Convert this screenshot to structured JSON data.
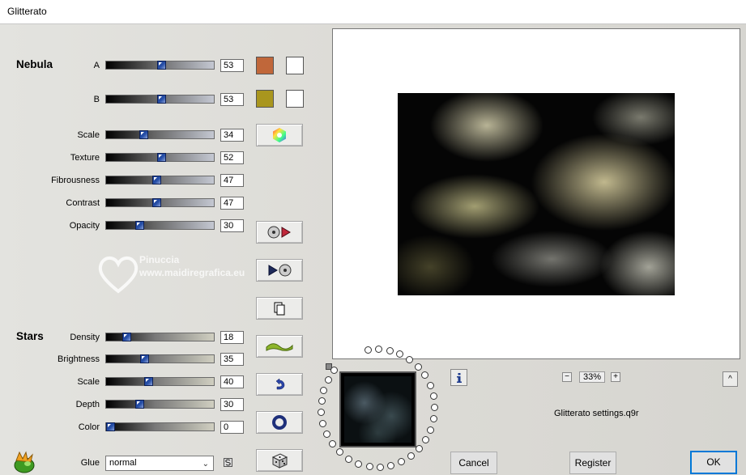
{
  "window": {
    "title": "Glitterato"
  },
  "nebula": {
    "title": "Nebula",
    "a": {
      "label": "A",
      "value": "53",
      "color": "#c0673a"
    },
    "b": {
      "label": "B",
      "value": "53",
      "color": "#a9961e"
    },
    "scale": {
      "label": "Scale",
      "value": "34"
    },
    "texture": {
      "label": "Texture",
      "value": "52"
    },
    "fibrousness": {
      "label": "Fibrousness",
      "value": "47"
    },
    "contrast": {
      "label": "Contrast",
      "value": "47"
    },
    "opacity": {
      "label": "Opacity",
      "value": "30"
    }
  },
  "stars": {
    "title": "Stars",
    "density": {
      "label": "Density",
      "value": "18"
    },
    "brightness": {
      "label": "Brightness",
      "value": "35"
    },
    "scale": {
      "label": "Scale",
      "value": "40"
    },
    "depth": {
      "label": "Depth",
      "value": "30"
    },
    "color": {
      "label": "Color",
      "value": "0"
    }
  },
  "glue": {
    "label": "Glue",
    "value": "normal"
  },
  "watermark": {
    "name": "Pinuccia",
    "url": "www.maidiregrafica.eu"
  },
  "preview": {
    "zoom": "33%",
    "settings_file": "Glitterato settings.q9r"
  },
  "buttons": {
    "cancel": "Cancel",
    "register": "Register",
    "ok": "OK"
  },
  "icons": {
    "color-wheel": "color-wheel-icon",
    "save-preset": "save-preset-icon",
    "load-preset": "load-preset-icon",
    "copy": "copy-icon",
    "wave": "wave-icon",
    "undo": "undo-icon",
    "ring": "ring-icon",
    "dice": "dice-icon",
    "info": "info-icon",
    "logo": "gecko-logo-icon"
  }
}
